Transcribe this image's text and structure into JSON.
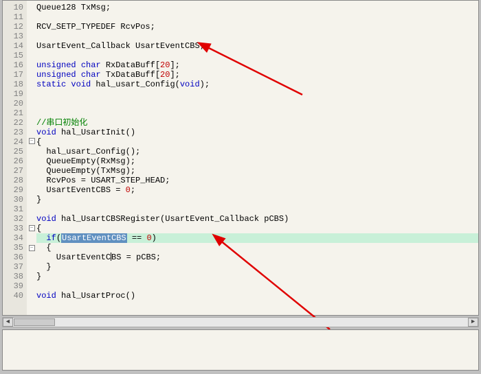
{
  "editor": {
    "first_line": 10,
    "lines": [
      {
        "n": 10,
        "frag": [
          [
            "",
            "Queue128 TxMsg;"
          ]
        ]
      },
      {
        "n": 11,
        "frag": []
      },
      {
        "n": 12,
        "frag": [
          [
            "",
            "RCV_SETP_TYPEDEF RcvPos;"
          ]
        ]
      },
      {
        "n": 13,
        "frag": []
      },
      {
        "n": 14,
        "frag": [
          [
            "",
            "UsartEvent_Callback UsartEventCBS;"
          ]
        ]
      },
      {
        "n": 15,
        "frag": []
      },
      {
        "n": 16,
        "frag": [
          [
            "kw",
            "unsigned"
          ],
          [
            "",
            " "
          ],
          [
            "kw",
            "char"
          ],
          [
            "",
            " RxDataBuff["
          ],
          [
            "num",
            "20"
          ],
          [
            "",
            "];"
          ]
        ]
      },
      {
        "n": 17,
        "frag": [
          [
            "kw",
            "unsigned"
          ],
          [
            "",
            " "
          ],
          [
            "kw",
            "char"
          ],
          [
            "",
            " TxDataBuff["
          ],
          [
            "num",
            "20"
          ],
          [
            "",
            "];"
          ]
        ]
      },
      {
        "n": 18,
        "frag": [
          [
            "kw",
            "static"
          ],
          [
            "",
            " "
          ],
          [
            "kw",
            "void"
          ],
          [
            "",
            " hal_usart_Config("
          ],
          [
            "kw",
            "void"
          ],
          [
            "",
            ");"
          ]
        ]
      },
      {
        "n": 19,
        "frag": []
      },
      {
        "n": 20,
        "frag": []
      },
      {
        "n": 21,
        "frag": []
      },
      {
        "n": 22,
        "frag": [
          [
            "cmt",
            "//串口初始化"
          ]
        ]
      },
      {
        "n": 23,
        "frag": [
          [
            "kw",
            "void"
          ],
          [
            "",
            " hal_UsartInit()"
          ]
        ]
      },
      {
        "n": 24,
        "frag": [
          [
            "",
            "{"
          ]
        ],
        "fold": "open"
      },
      {
        "n": 25,
        "frag": [
          [
            "",
            "  hal_usart_Config();"
          ]
        ]
      },
      {
        "n": 26,
        "frag": [
          [
            "",
            "  QueueEmpty(RxMsg);"
          ]
        ]
      },
      {
        "n": 27,
        "frag": [
          [
            "",
            "  QueueEmpty(TxMsg);"
          ]
        ]
      },
      {
        "n": 28,
        "frag": [
          [
            "",
            "  RcvPos = USART_STEP_HEAD;"
          ]
        ]
      },
      {
        "n": 29,
        "frag": [
          [
            "",
            "  UsartEventCBS = "
          ],
          [
            "num",
            "0"
          ],
          [
            "",
            ";"
          ]
        ]
      },
      {
        "n": 30,
        "frag": [
          [
            "",
            "}"
          ]
        ]
      },
      {
        "n": 31,
        "frag": []
      },
      {
        "n": 32,
        "frag": [
          [
            "kw",
            "void"
          ],
          [
            "",
            " hal_UsartCBSRegister(UsartEvent_Callback pCBS)"
          ]
        ]
      },
      {
        "n": 33,
        "frag": [
          [
            "",
            "{"
          ]
        ],
        "fold": "open"
      },
      {
        "n": 34,
        "frag": [
          [
            "",
            "  "
          ],
          [
            "kw",
            "if"
          ],
          [
            "",
            "("
          ],
          [
            "sel",
            "UsartEventCBS"
          ],
          [
            "",
            " == "
          ],
          [
            "num",
            "0"
          ],
          [
            "",
            ")"
          ]
        ],
        "highlight": true
      },
      {
        "n": 35,
        "frag": [
          [
            "",
            "  {"
          ]
        ],
        "fold": "open"
      },
      {
        "n": 36,
        "frag": [
          [
            "",
            "    UsartEventC"
          ],
          [
            "caret",
            ""
          ],
          [
            "",
            "BS = pCBS;"
          ]
        ]
      },
      {
        "n": 37,
        "frag": [
          [
            "",
            "  }"
          ]
        ]
      },
      {
        "n": 38,
        "frag": [
          [
            "",
            "}"
          ]
        ]
      },
      {
        "n": 39,
        "frag": []
      },
      {
        "n": 40,
        "frag": [
          [
            "kw",
            "void"
          ],
          [
            "",
            " hal_UsartProc()"
          ]
        ]
      }
    ]
  },
  "annotations": {
    "arrow1_desc": "red arrow pointing to UsartEventCBS declaration (line 14)",
    "arrow2_desc": "red arrow pointing to if(UsartEventCBS == 0) (line 34)"
  },
  "scrollbar": {
    "left_glyph": "◄",
    "right_glyph": "►"
  }
}
